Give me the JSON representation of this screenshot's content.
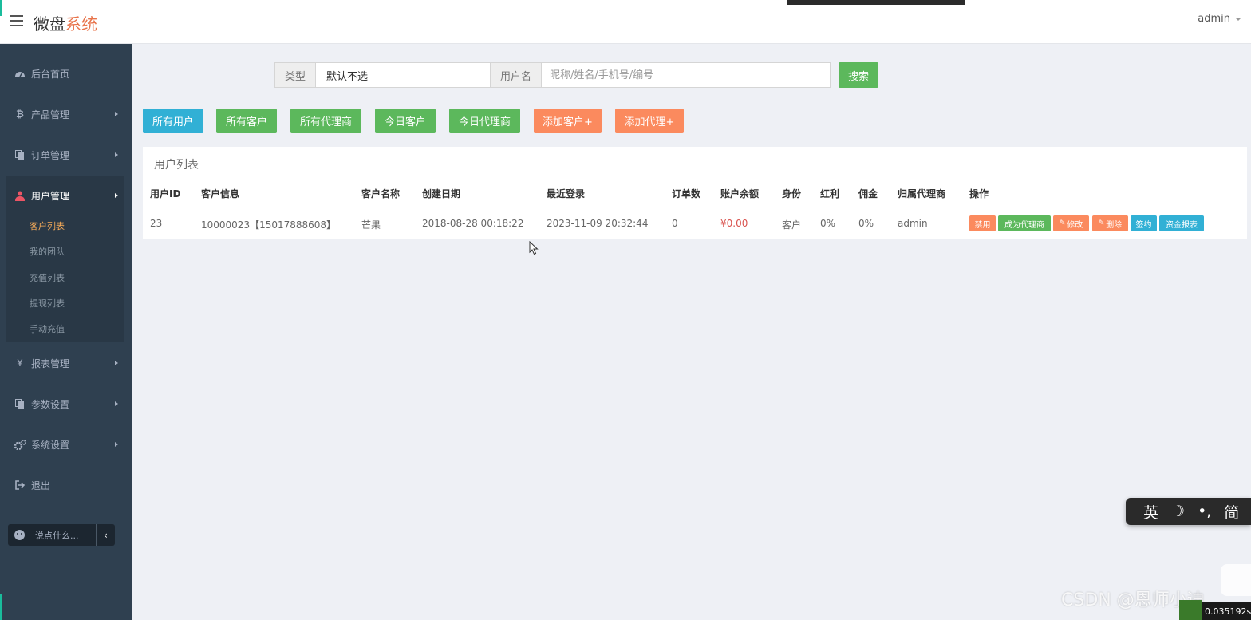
{
  "header": {
    "brand_part1": "微盘",
    "brand_part2": "系统",
    "user": "admin"
  },
  "sidebar": {
    "items": [
      {
        "label": "后台首页",
        "icon": "dashboard-icon"
      },
      {
        "label": "产品管理",
        "icon": "bitcoin-icon"
      },
      {
        "label": "订单管理",
        "icon": "copy-icon"
      },
      {
        "label": "用户管理",
        "icon": "user-icon"
      },
      {
        "label": "报表管理",
        "icon": "yen-icon"
      },
      {
        "label": "参数设置",
        "icon": "copy-icon"
      },
      {
        "label": "系统设置",
        "icon": "gears-icon"
      },
      {
        "label": "退出",
        "icon": "sign-out-icon"
      }
    ],
    "submenu": [
      "客户列表",
      "我的团队",
      "充值列表",
      "提现列表",
      "手动充值"
    ],
    "chat_placeholder": "说点什么..."
  },
  "search": {
    "type_label": "类型",
    "type_value": "默认不选",
    "name_label": "用户名",
    "name_placeholder": "昵称/姓名/手机号/编号",
    "search_button": "搜索"
  },
  "filters": [
    "所有用户",
    "所有客户",
    "所有代理商",
    "今日客户",
    "今日代理商",
    "添加客户+",
    "添加代理+"
  ],
  "table": {
    "title": "用户列表",
    "columns": [
      "用户ID",
      "客户信息",
      "客户名称",
      "创建日期",
      "最近登录",
      "订单数",
      "账户余额",
      "身份",
      "红利",
      "佣金",
      "归属代理商",
      "操作"
    ],
    "rows": [
      {
        "id": "23",
        "info": "10000023【15017888608】",
        "name": "芒果",
        "created": "2018-08-28 00:18:22",
        "last_login": "2023-11-09 20:32:44",
        "orders": "0",
        "balance": "¥0.00",
        "role": "客户",
        "bonus": "0%",
        "commission": "0%",
        "agent": "admin"
      }
    ],
    "actions": [
      "禁用",
      "成为代理商",
      "修改",
      "删除",
      "签约",
      "资金报表"
    ]
  },
  "ime": {
    "lang": "英",
    "script": "简"
  },
  "watermark": "CSDN @恩师小迪",
  "corner_text": "0.035192s"
}
